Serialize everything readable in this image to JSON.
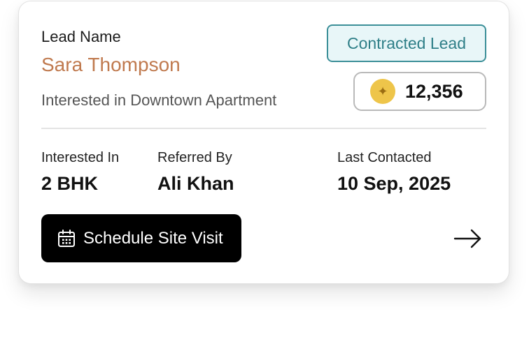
{
  "lead": {
    "label": "Lead Name",
    "name": "Sara Thompson",
    "interest_text": "Interested in Downtown Apartment",
    "status_badge": "Contracted Lead",
    "points": "12,356"
  },
  "details": {
    "interested_in": {
      "label": "Interested In",
      "value": "2 BHK"
    },
    "referred_by": {
      "label": "Referred By",
      "value": "Ali Khan"
    },
    "last_contacted": {
      "label": "Last Contacted",
      "value": "10 Sep, 2025"
    }
  },
  "actions": {
    "schedule_label": "Schedule Site Visit",
    "schedule_icon": "calendar-icon",
    "next_icon": "arrow-right-icon"
  },
  "colors": {
    "name_accent": "#c07a4f",
    "badge_border": "#3b8f98",
    "badge_fill": "#e8f6f8",
    "coin": "#eec54a",
    "primary_button": "#000000"
  }
}
